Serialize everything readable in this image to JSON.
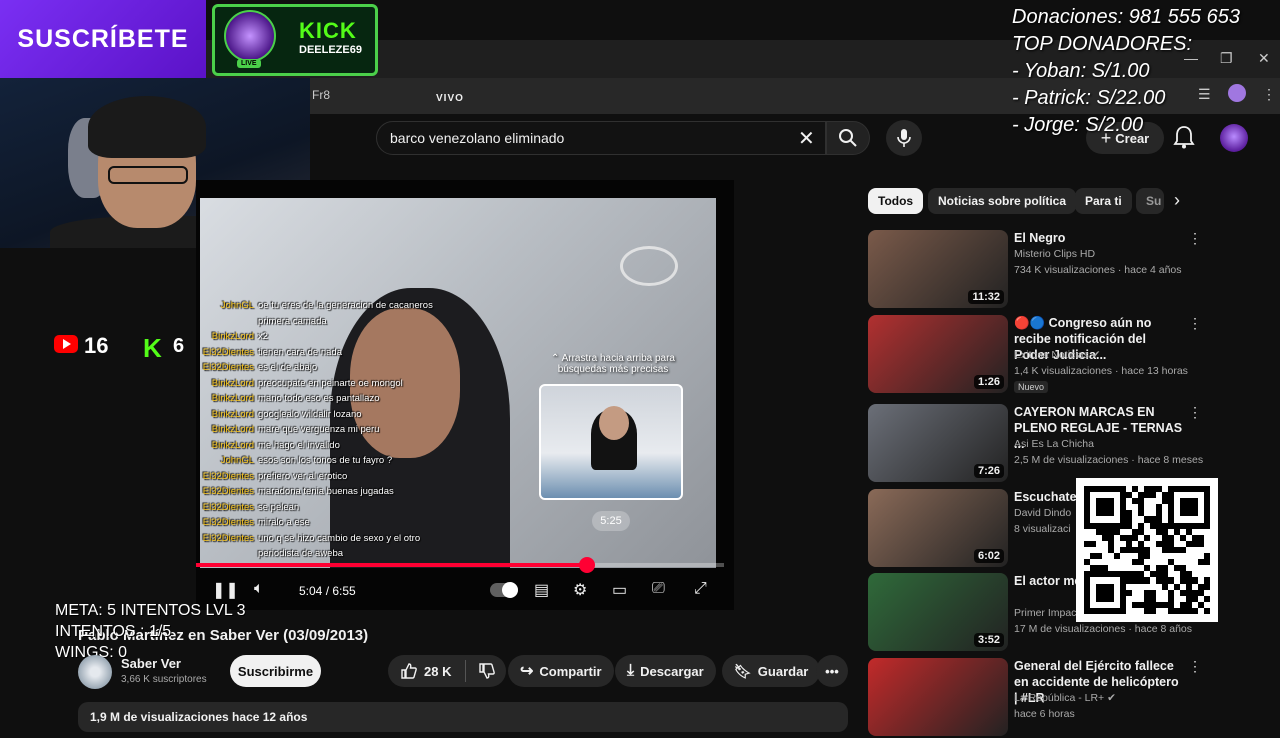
{
  "overlay": {
    "subscribe_label": "SUSCRÍBETE",
    "kick_title": "KICK",
    "kick_user": "DEELEZE69",
    "live_badge": "LIVE",
    "donations": [
      "Donaciones: 981 555 653",
      "TOP DONADORES:",
      "- Yoban: S/1.00",
      "- Patrick: S/22.00",
      "- Jorge: S/2.00"
    ],
    "youtube_count": "16",
    "kick_count": "6",
    "meta": [
      "META: 5 INTENTOS LVL 3",
      "INTENTOS : 1/5",
      "WINGS: 0"
    ]
  },
  "browser": {
    "tab_text": "Fr8"
  },
  "header": {
    "search_value": "barco venezolano eliminado",
    "create_label": "Crear",
    "create_plus": "+"
  },
  "player": {
    "live_label": "VIVO",
    "drag_tip": "⌃ Arrastra hacia arriba para búsquedas más precisas",
    "preview_time": "5:25",
    "timecode": "5:04 / 6:55",
    "progress_fraction": 0.74,
    "chat": [
      {
        "user": "JohnGL",
        "msg": "oe tu eres de la generacion de cacaneros"
      },
      {
        "user": "",
        "msg": "primera camada"
      },
      {
        "user": "BinkzLord",
        "msg": "x2"
      },
      {
        "user": "El32Dientes",
        "msg": "tienen cara de nada"
      },
      {
        "user": "El32Dientes",
        "msg": "es el de abajo"
      },
      {
        "user": "BinkzLord",
        "msg": "preocupate en peinarte oe mongol"
      },
      {
        "user": "BinkzLord",
        "msg": "mano todo eso es pantallazo"
      },
      {
        "user": "BinkzLord",
        "msg": "googlealo wildalir lozano"
      },
      {
        "user": "BinkzLord",
        "msg": "mare que verguenza mi peru"
      },
      {
        "user": "BinkzLord",
        "msg": "me hago el invalido"
      },
      {
        "user": "JohnGL",
        "msg": "esos son los tonos de tu fayro ?"
      },
      {
        "user": "El32Dientes",
        "msg": "prefiero ver al erotico"
      },
      {
        "user": "El32Dientes",
        "msg": "maradona tenia buenas jugadas"
      },
      {
        "user": "El32Dientes",
        "msg": "se pelean"
      },
      {
        "user": "El32Dientes",
        "msg": "miralo a ese"
      },
      {
        "user": "El32Dientes",
        "msg": "uno q se hizo cambio de sexo y el otro"
      },
      {
        "user": "",
        "msg": "periodista de aweba"
      }
    ]
  },
  "video": {
    "title": "Pablo Martínez en Saber Ver (03/09/2013)",
    "channel": "Saber Ver",
    "subscribers": "3,66 K suscriptores",
    "subscribe_button": "Suscribirme",
    "likes": "28 K",
    "share": "Compartir",
    "download": "Descargar",
    "save": "Guardar",
    "views": "1,9 M de visualizaciones  hace 12 años"
  },
  "chips": [
    "Todos",
    "Noticias sobre política",
    "Para ti",
    "Su"
  ],
  "recommendations": [
    {
      "title": "El Negro",
      "channel": "Misterio Clips HD",
      "meta": "734 K visualizaciones · hace 4 años",
      "duration": "11:32",
      "color": "#7a5a4a",
      "badge": ""
    },
    {
      "title": "🔴🔵 Congreso aún no recibe notificación del Poder Judicia...",
      "channel": "Exitosa Noticias ✔",
      "meta": "1,4 K visualizaciones · hace 13 horas",
      "duration": "1:26",
      "color": "#b23030",
      "badge": "Nuevo"
    },
    {
      "title": "CAYERON MARCAS EN PLENO REGLAJE - TERNAS ...",
      "channel": "Asi Es La Chicha",
      "meta": "2,5 M de visualizaciones · hace 8 meses",
      "duration": "7:26",
      "color": "#6b6f78",
      "badge": ""
    },
    {
      "title": "Escuchate a",
      "channel": "David Dindo",
      "meta": "8 visualizaci",
      "duration": "6:02",
      "color": "#8a6a58",
      "badge": ""
    },
    {
      "title": "El actor me Yañez pierd",
      "channel": "Primer Impact",
      "meta": "17 M de visualizaciones · hace 8 años",
      "duration": "3:52",
      "color": "#2f6a3a",
      "badge": ""
    },
    {
      "title": "General del Ejército fallece en accidente de helicóptero | #LR",
      "channel": "La República - LR+ ✔",
      "meta": "hace 6 horas",
      "duration": "",
      "color": "#c22a2a",
      "badge": ""
    }
  ],
  "icons": {
    "search": "search-icon",
    "mic": "mic-icon",
    "bell": "bell-icon",
    "like": "thumbs-up-icon",
    "dislike": "thumbs-down-icon"
  }
}
